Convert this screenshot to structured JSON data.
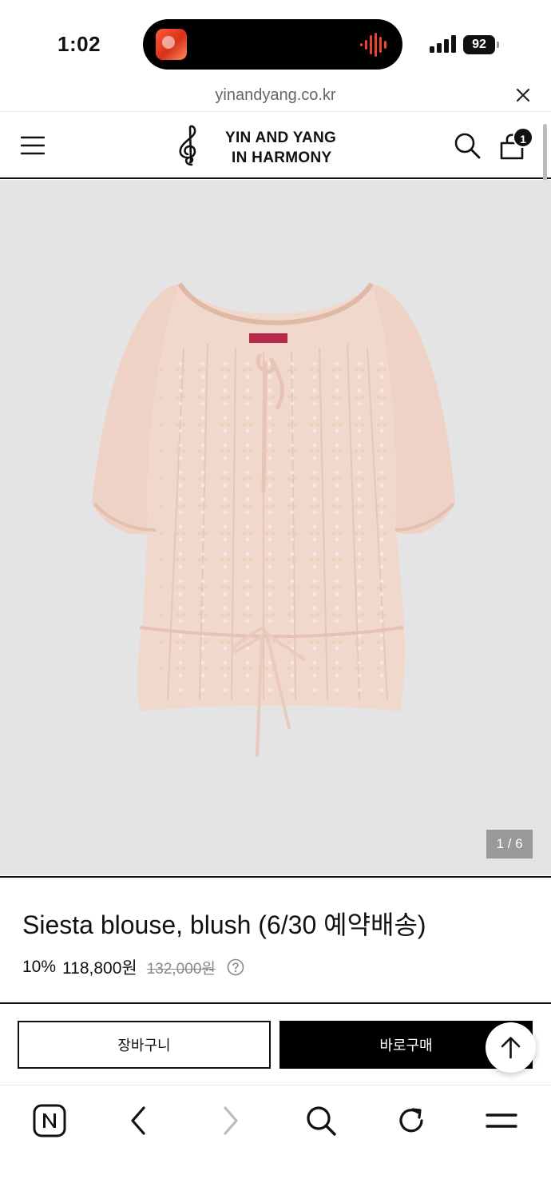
{
  "status_bar": {
    "time": "1:02",
    "battery": "92"
  },
  "url_bar": {
    "domain": "yinandyang.co.kr"
  },
  "header": {
    "logo_line1": "YIN AND YANG",
    "logo_line2": "IN HARMONY",
    "cart_count": "1"
  },
  "product": {
    "image_counter": "1 / 6",
    "title": "Siesta blouse, blush (6/30 예약배송)",
    "discount": "10%",
    "price": "118,800원",
    "original_price": "132,000원"
  },
  "actions": {
    "cart_label": "장바구니",
    "buy_label": "바로구매"
  },
  "colors": {
    "accent": "#000000",
    "image_bg": "#e4e4e4",
    "blouse": "#f0d6cc"
  },
  "icons": [
    "menu-icon",
    "treble-clef-logo",
    "search-icon",
    "cart-icon",
    "help-icon",
    "arrow-up-icon",
    "naver-icon",
    "back-icon",
    "forward-icon",
    "refresh-icon",
    "hamburger-icon"
  ]
}
